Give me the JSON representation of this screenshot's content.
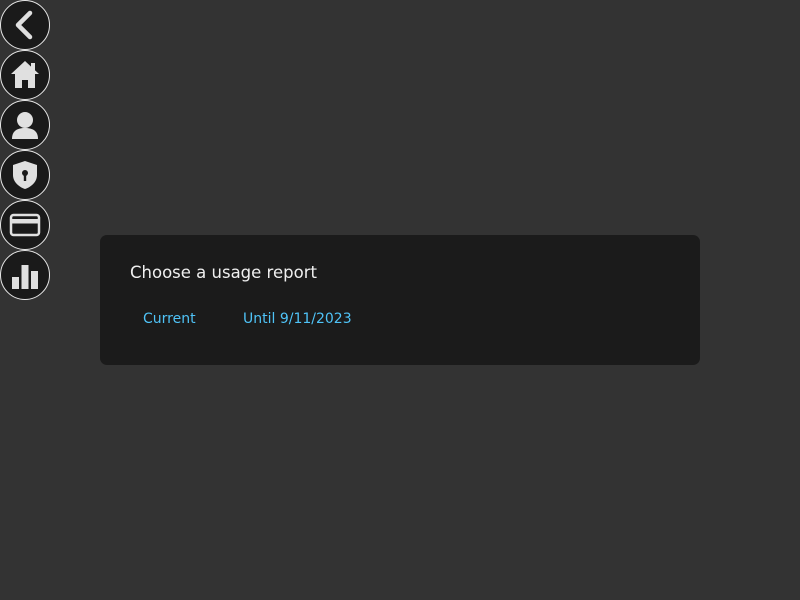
{
  "sidebar": {
    "items": [
      {
        "name": "back-button",
        "icon": "chevron-left-icon"
      },
      {
        "name": "home-button",
        "icon": "home-icon"
      },
      {
        "name": "profile-button",
        "icon": "user-icon"
      },
      {
        "name": "security-button",
        "icon": "shield-icon"
      },
      {
        "name": "billing-button",
        "icon": "credit-card-icon"
      },
      {
        "name": "usage-button",
        "icon": "bar-chart-icon"
      }
    ]
  },
  "dialog": {
    "title": "Choose a usage report",
    "options": [
      {
        "label": "Current"
      },
      {
        "label": "Until 9/11/2023"
      }
    ]
  },
  "colors": {
    "background": "#333333",
    "dialog_background": "#1b1b1b",
    "accent": "#4fc3f7",
    "icon": "#e0e0e0"
  }
}
